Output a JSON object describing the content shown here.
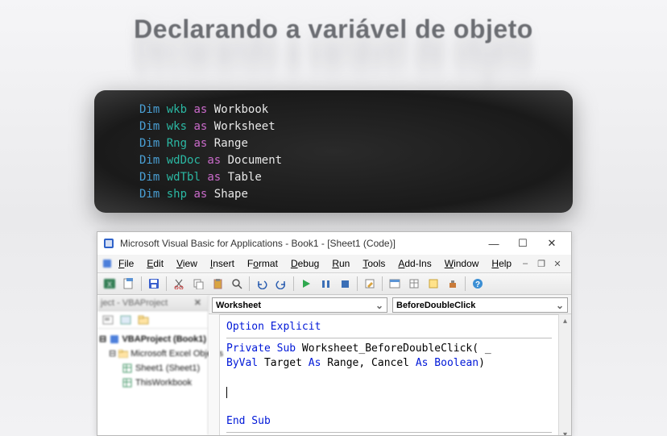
{
  "hero": {
    "title": "Declarando a variável de objeto"
  },
  "codeblock": {
    "lines": [
      {
        "var": "wkb",
        "type": "Workbook"
      },
      {
        "var": "wks",
        "type": "Worksheet"
      },
      {
        "var": "Rng",
        "type": "Range"
      },
      {
        "var": "wdDoc",
        "type": "Document"
      },
      {
        "var": "wdTbl",
        "type": "Table"
      },
      {
        "var": "shp",
        "type": "Shape"
      }
    ],
    "keyword_dim": "Dim",
    "keyword_as": "as"
  },
  "vba": {
    "titlebar": "Microsoft Visual Basic for Applications - Book1 - [Sheet1 (Code)]",
    "menus": [
      "File",
      "Edit",
      "View",
      "Insert",
      "Format",
      "Debug",
      "Run",
      "Tools",
      "Add-Ins",
      "Window",
      "Help"
    ],
    "project_pane_title": "ject - VBAProject",
    "tree": {
      "root": "VBAProject (Book1)",
      "folder": "Microsoft Excel Objects",
      "items": [
        "Sheet1 (Sheet1)",
        "ThisWorkbook"
      ]
    },
    "object_combo": "Worksheet",
    "proc_combo": "BeforeDoubleClick",
    "editor": {
      "line1": "Option Explicit",
      "sub_kw": "Private Sub",
      "sub_name": "Worksheet_BeforeDoubleClick( _",
      "line3a": "ByVal",
      "line3b": " Target ",
      "line3c": "As",
      "line3d": " Range, Cancel ",
      "line3e": "As Boolean",
      "line3f": ")",
      "end": "End Sub"
    }
  }
}
